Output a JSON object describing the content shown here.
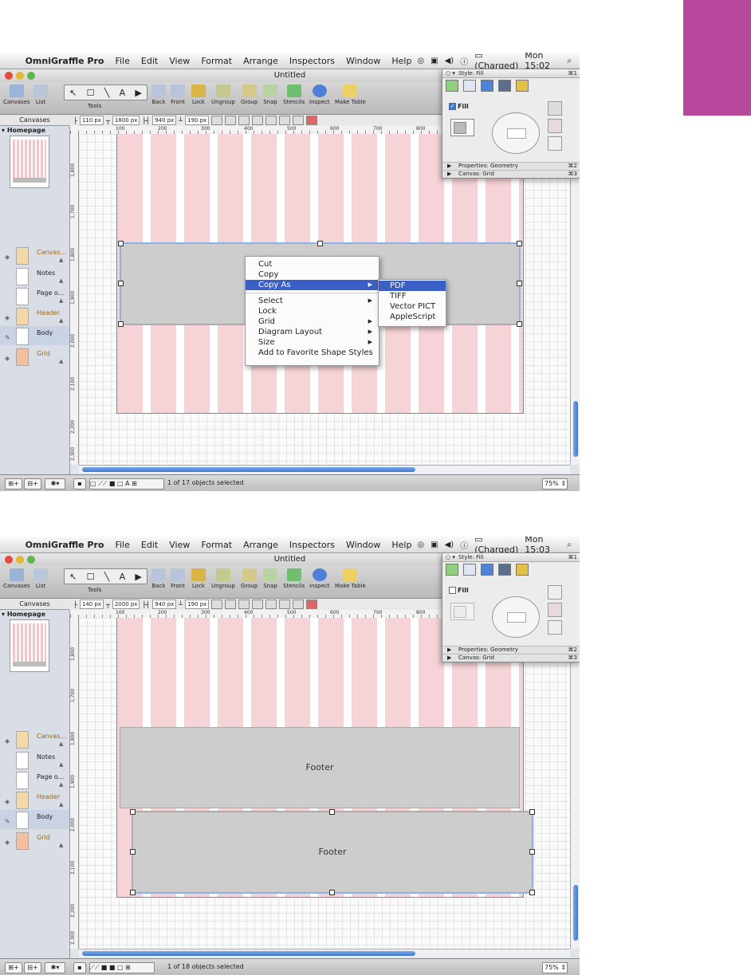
{
  "screens": [
    {
      "menubar": {
        "app_name": "OmniGraffle Pro",
        "menus": [
          "File",
          "Edit",
          "View",
          "Format",
          "Arrange",
          "Inspectors",
          "Window",
          "Help"
        ],
        "battery": "(Charged)",
        "clock": "Mon 15:02"
      },
      "window_title": "Untitled",
      "toolbar": {
        "canvases": "Canvases",
        "list": "List",
        "tools": "Tools",
        "back": "Back",
        "front": "Front",
        "lock": "Lock",
        "ungroup": "Ungroup",
        "group": "Group",
        "snap": "Snap",
        "stencils": "Stencils",
        "inspect": "Inspect",
        "make_table": "Make Table"
      },
      "sidebar_header": "Canvases",
      "geometry": {
        "x": "110 px",
        "y": "1800 px",
        "w": "940 px",
        "h": "190 px"
      },
      "sidebar": {
        "canvas": "Homepage",
        "layers": [
          {
            "name": "Canvas..."
          },
          {
            "name": "Notes"
          },
          {
            "name": "Page o..."
          },
          {
            "name": "Header"
          },
          {
            "name": "Body"
          },
          {
            "name": "Grid"
          }
        ]
      },
      "ruler": {
        "h_ticks": [
          "100",
          "200",
          "300",
          "400",
          "500",
          "600",
          "700",
          "800"
        ],
        "v_ticks": [
          "1,800",
          "1,700",
          "1,800",
          "1,900",
          "2,000",
          "2,100",
          "2,200",
          "2,300"
        ]
      },
      "status": "1 of 17 objects selected",
      "zoom": "75%",
      "context_menu": {
        "items": [
          "Cut",
          "Copy",
          "Copy As",
          "Select",
          "Lock",
          "Grid",
          "Diagram Layout",
          "Size",
          "Add to Favorite Shape Styles"
        ],
        "submenu": [
          "PDF",
          "TIFF",
          "Vector PICT",
          "AppleScript"
        ]
      },
      "inspector": {
        "title": "Style: Fill",
        "shortcut": "⌘1",
        "fill_label": "Fill",
        "fill_checked": true,
        "properties": "Properties: Geometry",
        "properties_shortcut": "⌘2",
        "canvas_row": "Canvas: Grid",
        "canvas_shortcut": "⌘3"
      }
    },
    {
      "menubar": {
        "app_name": "OmniGraffle Pro",
        "menus": [
          "File",
          "Edit",
          "View",
          "Format",
          "Arrange",
          "Inspectors",
          "Window",
          "Help"
        ],
        "battery": "(Charged)",
        "clock": "Mon 15:03"
      },
      "window_title": "Untitled",
      "toolbar": {
        "canvases": "Canvases",
        "list": "List",
        "tools": "Tools",
        "back": "Back",
        "front": "Front",
        "lock": "Lock",
        "ungroup": "Ungroup",
        "group": "Group",
        "snap": "Snap",
        "stencils": "Stencils",
        "inspect": "Inspect",
        "make_table": "Make Table"
      },
      "sidebar_header": "Canvases",
      "geometry": {
        "x": "140 px",
        "y": "2000 px",
        "w": "940 px",
        "h": "190 px"
      },
      "sidebar": {
        "canvas": "Homepage",
        "layers": [
          {
            "name": "Canvas..."
          },
          {
            "name": "Notes"
          },
          {
            "name": "Page o..."
          },
          {
            "name": "Header"
          },
          {
            "name": "Body"
          },
          {
            "name": "Grid"
          }
        ]
      },
      "ruler": {
        "h_ticks": [
          "100",
          "200",
          "300",
          "400",
          "500",
          "600",
          "700",
          "800"
        ],
        "v_ticks": [
          "1,800",
          "1,700",
          "1,800",
          "1,900",
          "2,000",
          "2,100",
          "2,200",
          "2,300"
        ]
      },
      "status": "1 of 18 objects selected",
      "zoom": "75%",
      "footer_labels": [
        "Footer",
        "Footer"
      ],
      "inspector": {
        "title": "Style: Fill",
        "shortcut": "⌘1",
        "fill_label": "Fill",
        "fill_checked": false,
        "properties": "Properties: Geometry",
        "properties_shortcut": "⌘2",
        "canvas_row": "Canvas: Grid",
        "canvas_shortcut": "⌘3"
      }
    }
  ]
}
